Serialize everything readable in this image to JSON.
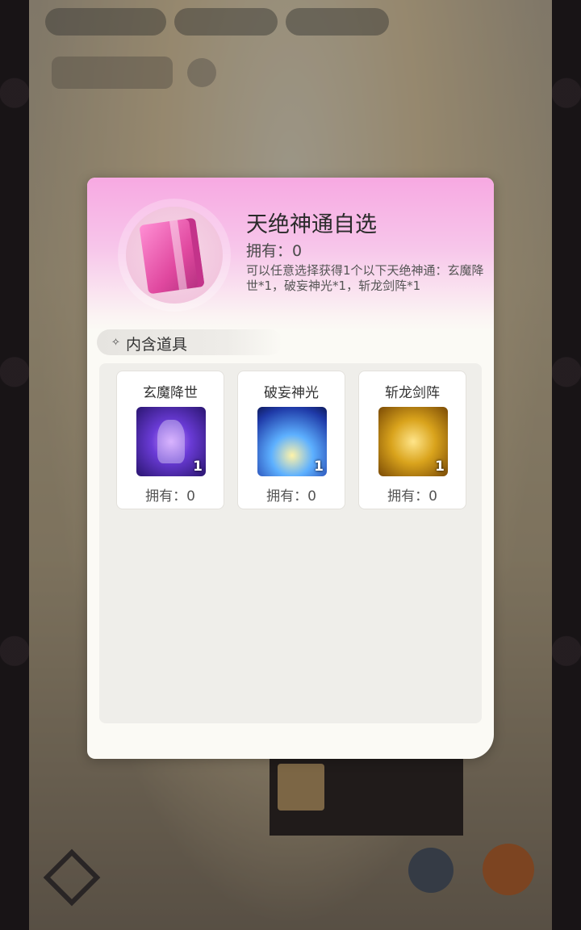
{
  "modal": {
    "item_title": "天绝神通自选",
    "owned_text": "拥有：0",
    "description": "可以任意选择获得1个以下天绝神通：玄魔降世*1，破妄神光*1，斩龙剑阵*1",
    "section_icon": "✧",
    "section_label": "内含道具",
    "items": [
      {
        "name": "玄魔降世",
        "qty": "1",
        "owned": "拥有：0",
        "icon": "purple-figure-icon"
      },
      {
        "name": "破妄神光",
        "qty": "1",
        "owned": "拥有：0",
        "icon": "blue-light-burst-icon"
      },
      {
        "name": "斩龙剑阵",
        "qty": "1",
        "owned": "拥有：0",
        "icon": "gold-dragon-icon"
      }
    ]
  },
  "colors": {
    "header_pink": "#f7a9e2",
    "panel_bg": "#efeeea",
    "modal_bg": "#fbfaf5"
  }
}
